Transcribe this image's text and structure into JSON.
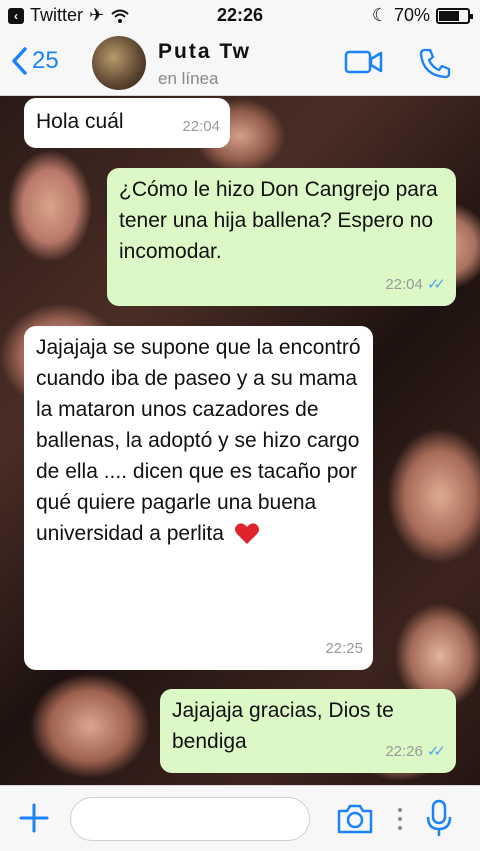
{
  "status_bar": {
    "carrier": "Twitter",
    "time": "22:26",
    "battery": "70%",
    "battery_level": 0.7
  },
  "header": {
    "back_count": "25",
    "contact_name": "Puta  Tw",
    "contact_status": "en línea"
  },
  "messages": [
    {
      "direction": "in",
      "text": "Hola cuál",
      "time": "22:04",
      "read": false
    },
    {
      "direction": "out",
      "text": "¿Cómo le hizo Don Cangrejo para tener una hija ballena? Espero no incomodar.",
      "time": "22:04",
      "read": true
    },
    {
      "direction": "in",
      "text": "Jajajaja se supone que la encontró cuando iba de paseo y a su mama la mataron unos cazadores de ballenas, la adoptó y se hizo cargo de ella .... dicen que es tacaño por qué quiere pagarle una buena universidad a perlita",
      "time": "22:25",
      "read": false,
      "emoji": "heart-icon"
    },
    {
      "direction": "out",
      "text": "Jajajaja gracias, Dios te bendiga",
      "time": "22:26",
      "read": true
    }
  ],
  "input_bar": {
    "placeholder": ""
  },
  "colors": {
    "accent": "#1a82fb",
    "outgoing_bubble": "#dcf8c6",
    "incoming_bubble": "#ffffff",
    "read_ticks": "#4fa6e8",
    "heart": "#e0242e"
  }
}
